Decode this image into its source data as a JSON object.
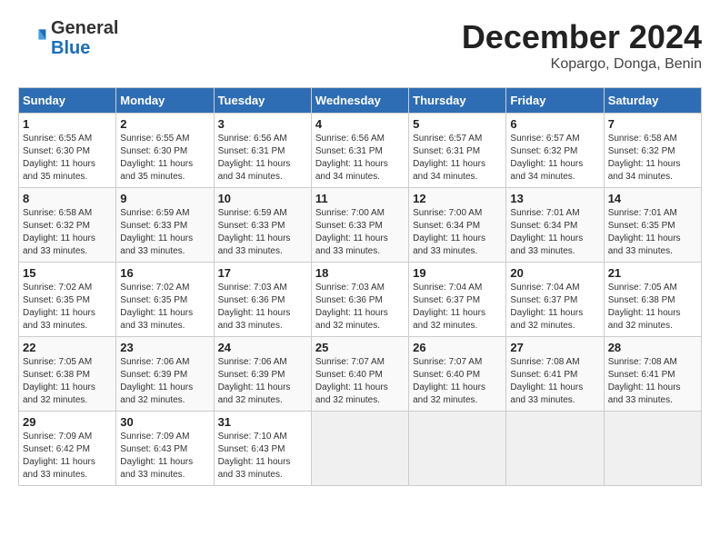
{
  "header": {
    "logo_general": "General",
    "logo_blue": "Blue",
    "month_title": "December 2024",
    "location": "Kopargo, Donga, Benin"
  },
  "calendar": {
    "days_of_week": [
      "Sunday",
      "Monday",
      "Tuesday",
      "Wednesday",
      "Thursday",
      "Friday",
      "Saturday"
    ],
    "weeks": [
      [
        {
          "day": "",
          "info": ""
        },
        {
          "day": "2",
          "info": "Sunrise: 6:55 AM\nSunset: 6:30 PM\nDaylight: 11 hours and 35 minutes."
        },
        {
          "day": "3",
          "info": "Sunrise: 6:56 AM\nSunset: 6:31 PM\nDaylight: 11 hours and 34 minutes."
        },
        {
          "day": "4",
          "info": "Sunrise: 6:56 AM\nSunset: 6:31 PM\nDaylight: 11 hours and 34 minutes."
        },
        {
          "day": "5",
          "info": "Sunrise: 6:57 AM\nSunset: 6:31 PM\nDaylight: 11 hours and 34 minutes."
        },
        {
          "day": "6",
          "info": "Sunrise: 6:57 AM\nSunset: 6:32 PM\nDaylight: 11 hours and 34 minutes."
        },
        {
          "day": "7",
          "info": "Sunrise: 6:58 AM\nSunset: 6:32 PM\nDaylight: 11 hours and 34 minutes."
        }
      ],
      [
        {
          "day": "8",
          "info": "Sunrise: 6:58 AM\nSunset: 6:32 PM\nDaylight: 11 hours and 33 minutes."
        },
        {
          "day": "9",
          "info": "Sunrise: 6:59 AM\nSunset: 6:33 PM\nDaylight: 11 hours and 33 minutes."
        },
        {
          "day": "10",
          "info": "Sunrise: 6:59 AM\nSunset: 6:33 PM\nDaylight: 11 hours and 33 minutes."
        },
        {
          "day": "11",
          "info": "Sunrise: 7:00 AM\nSunset: 6:33 PM\nDaylight: 11 hours and 33 minutes."
        },
        {
          "day": "12",
          "info": "Sunrise: 7:00 AM\nSunset: 6:34 PM\nDaylight: 11 hours and 33 minutes."
        },
        {
          "day": "13",
          "info": "Sunrise: 7:01 AM\nSunset: 6:34 PM\nDaylight: 11 hours and 33 minutes."
        },
        {
          "day": "14",
          "info": "Sunrise: 7:01 AM\nSunset: 6:35 PM\nDaylight: 11 hours and 33 minutes."
        }
      ],
      [
        {
          "day": "15",
          "info": "Sunrise: 7:02 AM\nSunset: 6:35 PM\nDaylight: 11 hours and 33 minutes."
        },
        {
          "day": "16",
          "info": "Sunrise: 7:02 AM\nSunset: 6:35 PM\nDaylight: 11 hours and 33 minutes."
        },
        {
          "day": "17",
          "info": "Sunrise: 7:03 AM\nSunset: 6:36 PM\nDaylight: 11 hours and 33 minutes."
        },
        {
          "day": "18",
          "info": "Sunrise: 7:03 AM\nSunset: 6:36 PM\nDaylight: 11 hours and 32 minutes."
        },
        {
          "day": "19",
          "info": "Sunrise: 7:04 AM\nSunset: 6:37 PM\nDaylight: 11 hours and 32 minutes."
        },
        {
          "day": "20",
          "info": "Sunrise: 7:04 AM\nSunset: 6:37 PM\nDaylight: 11 hours and 32 minutes."
        },
        {
          "day": "21",
          "info": "Sunrise: 7:05 AM\nSunset: 6:38 PM\nDaylight: 11 hours and 32 minutes."
        }
      ],
      [
        {
          "day": "22",
          "info": "Sunrise: 7:05 AM\nSunset: 6:38 PM\nDaylight: 11 hours and 32 minutes."
        },
        {
          "day": "23",
          "info": "Sunrise: 7:06 AM\nSunset: 6:39 PM\nDaylight: 11 hours and 32 minutes."
        },
        {
          "day": "24",
          "info": "Sunrise: 7:06 AM\nSunset: 6:39 PM\nDaylight: 11 hours and 32 minutes."
        },
        {
          "day": "25",
          "info": "Sunrise: 7:07 AM\nSunset: 6:40 PM\nDaylight: 11 hours and 32 minutes."
        },
        {
          "day": "26",
          "info": "Sunrise: 7:07 AM\nSunset: 6:40 PM\nDaylight: 11 hours and 32 minutes."
        },
        {
          "day": "27",
          "info": "Sunrise: 7:08 AM\nSunset: 6:41 PM\nDaylight: 11 hours and 33 minutes."
        },
        {
          "day": "28",
          "info": "Sunrise: 7:08 AM\nSunset: 6:41 PM\nDaylight: 11 hours and 33 minutes."
        }
      ],
      [
        {
          "day": "29",
          "info": "Sunrise: 7:09 AM\nSunset: 6:42 PM\nDaylight: 11 hours and 33 minutes."
        },
        {
          "day": "30",
          "info": "Sunrise: 7:09 AM\nSunset: 6:43 PM\nDaylight: 11 hours and 33 minutes."
        },
        {
          "day": "31",
          "info": "Sunrise: 7:10 AM\nSunset: 6:43 PM\nDaylight: 11 hours and 33 minutes."
        },
        {
          "day": "",
          "info": ""
        },
        {
          "day": "",
          "info": ""
        },
        {
          "day": "",
          "info": ""
        },
        {
          "day": "",
          "info": ""
        }
      ]
    ],
    "first_week_sunday": {
      "day": "1",
      "info": "Sunrise: 6:55 AM\nSunset: 6:30 PM\nDaylight: 11 hours and 35 minutes."
    }
  }
}
